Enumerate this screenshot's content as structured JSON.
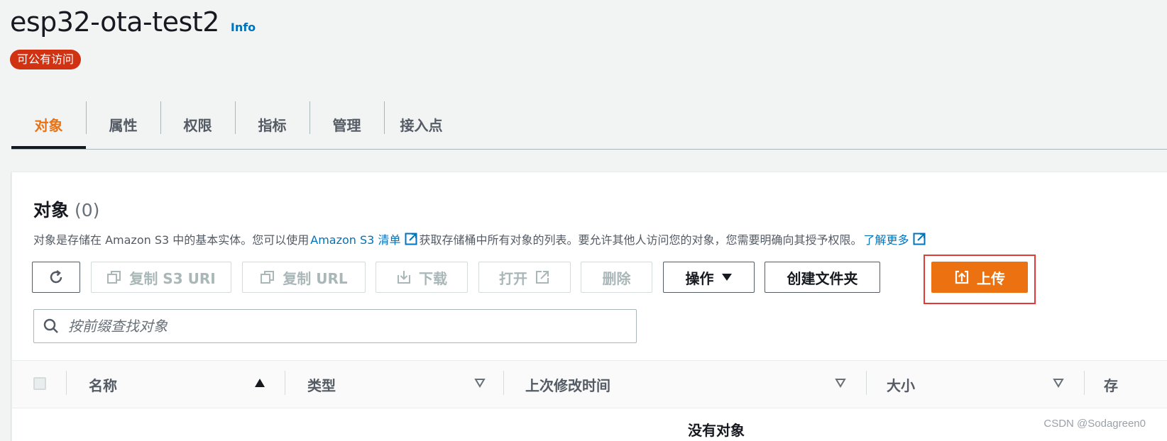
{
  "header": {
    "bucket_name": "esp32-ota-test2",
    "info_link": "Info",
    "access_badge": "可公有访问"
  },
  "tabs": [
    {
      "label": "对象",
      "active": true
    },
    {
      "label": "属性",
      "active": false
    },
    {
      "label": "权限",
      "active": false
    },
    {
      "label": "指标",
      "active": false
    },
    {
      "label": "管理",
      "active": false
    },
    {
      "label": "接入点",
      "active": false
    }
  ],
  "objects_panel": {
    "title": "对象",
    "count": "(0)",
    "description_prefix": "对象是存储在 Amazon S3 中的基本实体。您可以使用",
    "inventory_link": "Amazon S3 清单",
    "description_middle": "获取存储桶中所有对象的列表。要允许其他人访问您的对象，您需要明确向其授予权限。",
    "learn_more_link": "了解更多"
  },
  "toolbar": {
    "copy_s3_uri": "复制 S3 URI",
    "copy_url": "复制 URL",
    "download": "下载",
    "open": "打开",
    "delete": "删除",
    "actions": "操作",
    "create_folder": "创建文件夹",
    "upload": "上传"
  },
  "search": {
    "placeholder": "按前缀查找对象"
  },
  "table": {
    "columns": [
      "名称",
      "类型",
      "上次修改时间",
      "大小",
      "存"
    ],
    "empty_message": "没有对象"
  },
  "watermark": "CSDN @Sodagreen0",
  "colors": {
    "accent_orange": "#ec7211",
    "link_blue": "#0073bb",
    "badge_red": "#d13212",
    "highlight_red": "#e53935"
  }
}
